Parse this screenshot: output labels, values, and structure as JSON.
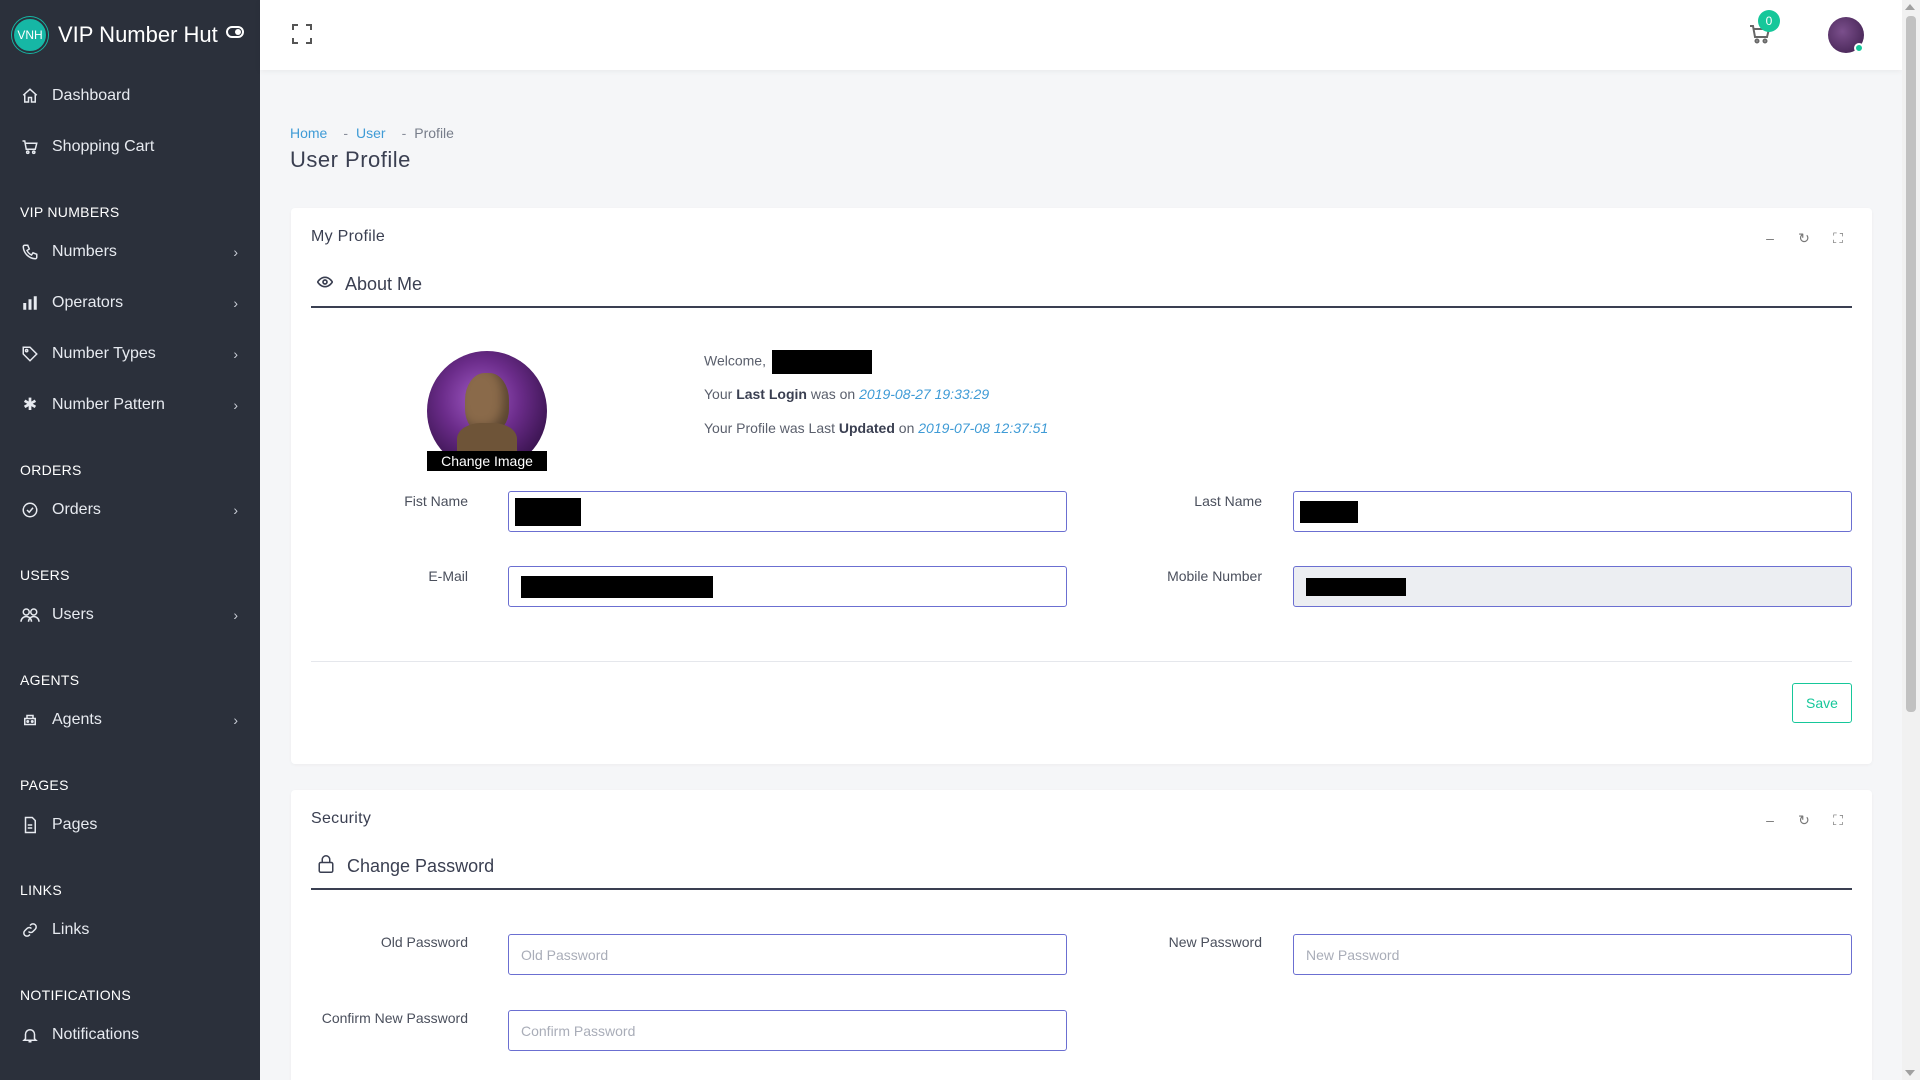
{
  "brand": {
    "logo_text": "VNH",
    "title": "VIP Number Hut"
  },
  "sidebar": {
    "top_items": [
      {
        "label": "Dashboard",
        "icon": "home-icon"
      },
      {
        "label": "Shopping Cart",
        "icon": "cart-icon"
      }
    ],
    "sections": [
      {
        "title": "VIP NUMBERS",
        "items": [
          {
            "label": "Numbers",
            "icon": "phone-icon"
          },
          {
            "label": "Operators",
            "icon": "bar-chart-icon"
          },
          {
            "label": "Number Types",
            "icon": "tag-icon"
          },
          {
            "label": "Number Pattern",
            "icon": "asterisk-icon"
          }
        ]
      },
      {
        "title": "ORDERS",
        "items": [
          {
            "label": "Orders",
            "icon": "check-circle-icon"
          }
        ]
      },
      {
        "title": "USERS",
        "items": [
          {
            "label": "Users",
            "icon": "users-icon"
          }
        ]
      },
      {
        "title": "AGENTS",
        "items": [
          {
            "label": "Agents",
            "icon": "agent-icon"
          }
        ]
      },
      {
        "title": "PAGES",
        "items": [
          {
            "label": "Pages",
            "icon": "page-icon"
          }
        ]
      },
      {
        "title": "LINKS",
        "items": [
          {
            "label": "Links",
            "icon": "link-icon"
          }
        ]
      },
      {
        "title": "NOTIFICATIONS",
        "items": [
          {
            "label": "Notifications",
            "icon": "bell-icon"
          }
        ]
      }
    ]
  },
  "topbar": {
    "cart_count": "0"
  },
  "breadcrumb": {
    "home": "Home",
    "user": "User",
    "current": "Profile",
    "sep": "-"
  },
  "page_title": "User Profile",
  "profile_card": {
    "title": "My Profile",
    "section_title": "About Me",
    "change_image": "Change Image",
    "welcome": "Welcome,",
    "last_login_prefix": "Your",
    "last_login_bold": "Last Login",
    "last_login_mid": "was on",
    "last_login_value": "2019-08-27 19:33:29",
    "updated_prefix": "Your Profile was Last",
    "updated_bold": "Updated",
    "updated_mid": "on",
    "updated_value": "2019-07-08 12:37:51",
    "first_name_label": "Fist Name",
    "last_name_label": "Last Name",
    "email_label": "E-Mail",
    "mobile_label": "Mobile Number",
    "save": "Save"
  },
  "security_card": {
    "title": "Security",
    "section_title": "Change Password",
    "old_label": "Old Password",
    "old_placeholder": "Old Password",
    "new_label": "New Password",
    "new_placeholder": "New Password",
    "confirm_label": "Confirm New Password",
    "confirm_placeholder": "Confirm Password"
  },
  "colors": {
    "sidebar_bg": "#2b303b",
    "accent": "#16c79a",
    "link": "#3f9bd6",
    "input_border": "#6b6fd1"
  }
}
